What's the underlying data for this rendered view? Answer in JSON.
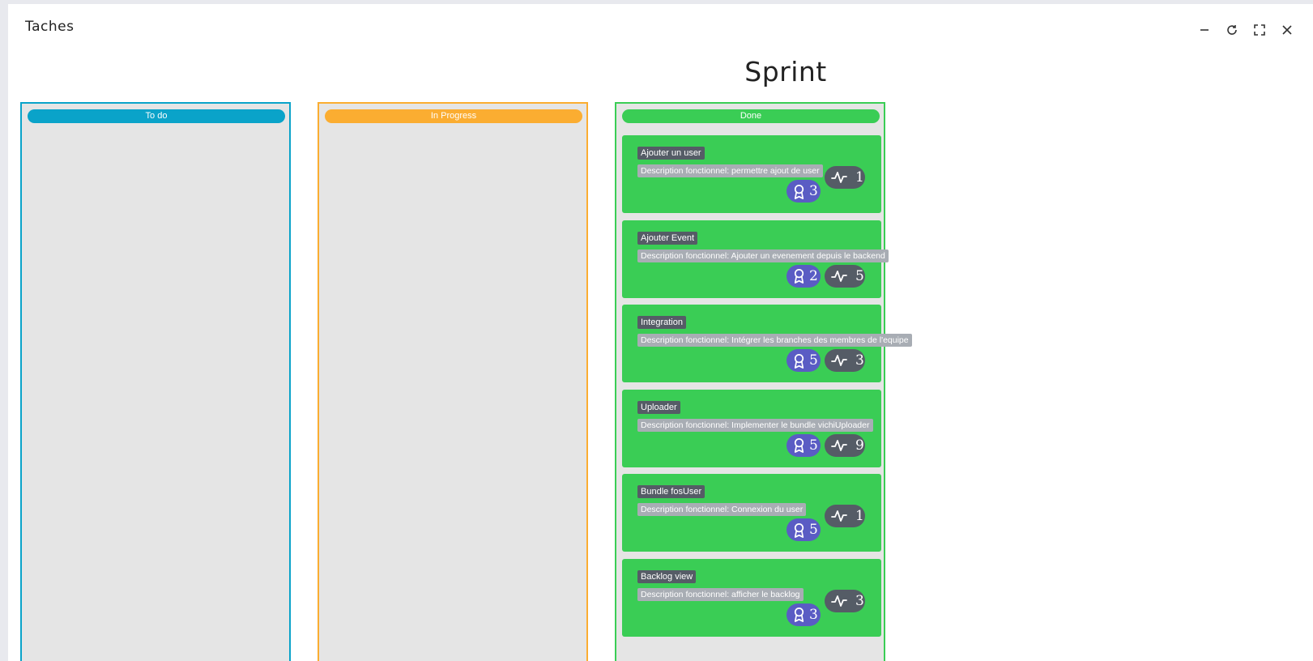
{
  "window": {
    "title": "Taches"
  },
  "board": {
    "title": "Sprint"
  },
  "columns": {
    "todo": {
      "label": "To do",
      "color": "#0aa3c9"
    },
    "in_progress": {
      "label": "In Progress",
      "color": "#fbad31"
    },
    "done": {
      "label": "Done",
      "color": "#3acd55"
    }
  },
  "done_cards": [
    {
      "title": "Ajouter un user",
      "description": "Description fonctionnel: permettre ajout de user",
      "points": "3",
      "effort": "1",
      "layout": "stacked"
    },
    {
      "title": "Ajouter Event",
      "description": "Description fonctionnel: Ajouter un evenement depuis le backend",
      "points": "2",
      "effort": "5",
      "layout": "inline"
    },
    {
      "title": "Integration",
      "description": "Description fonctionnel: Intégrer les branches des membres de l'equipe",
      "points": "5",
      "effort": "3",
      "layout": "inline"
    },
    {
      "title": "Uploader",
      "description": "Description fonctionnel: Implementer le bundle vichiUploader",
      "points": "5",
      "effort": "9",
      "layout": "inline"
    },
    {
      "title": "Bundle fosUser",
      "description": "Description fonctionnel: Connexion du user",
      "points": "5",
      "effort": "1",
      "layout": "stacked"
    },
    {
      "title": "Backlog view",
      "description": "Description fonctionnel: afficher le backlog",
      "points": "3",
      "effort": "3",
      "layout": "stacked"
    }
  ],
  "icons": {
    "points": "award-icon",
    "effort": "activity-icon"
  },
  "colors": {
    "points_badge": "#5a5cc4",
    "effort_badge": "#555c66",
    "card_bg": "#3acd55"
  }
}
